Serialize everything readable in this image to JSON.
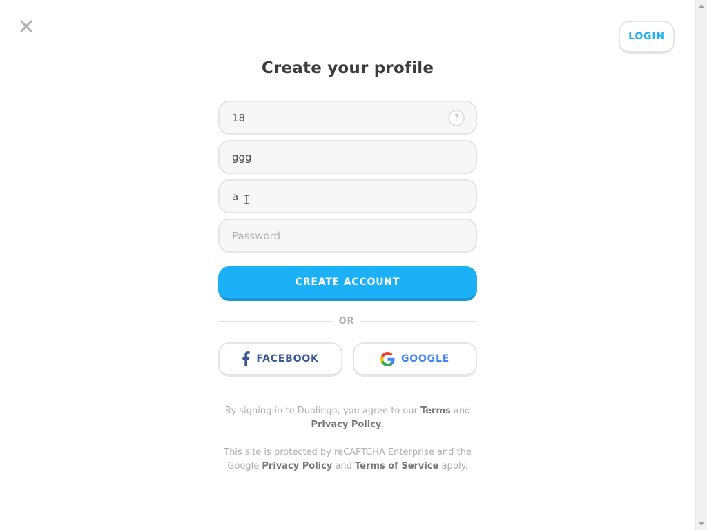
{
  "header": {
    "close_icon": "close-icon",
    "login_label": "LOGIN"
  },
  "form": {
    "title": "Create your profile",
    "age": {
      "value": "18",
      "help_icon": "?"
    },
    "name": {
      "value": "ggg"
    },
    "email": {
      "value": "a"
    },
    "password": {
      "value": "",
      "placeholder": "Password"
    },
    "create_label": "CREATE ACCOUNT"
  },
  "divider": {
    "label": "OR"
  },
  "social": {
    "facebook_label": "FACEBOOK",
    "google_label": "GOOGLE"
  },
  "legal": {
    "line1_prefix": "By signing in to Duolingo, you agree to our ",
    "terms": "Terms",
    "and1": " and ",
    "privacy": "Privacy Policy",
    "period": ".",
    "line2_prefix": "This site is protected by reCAPTCHA Enterprise and the Google ",
    "privacy2": "Privacy Policy",
    "and2": " and ",
    "terms_of_service": "Terms of Service",
    "suffix": " apply."
  },
  "colors": {
    "accent": "#1cb0f6",
    "accent_dark": "#1899d6",
    "facebook": "#3b5998",
    "google_text": "#4285f4"
  }
}
